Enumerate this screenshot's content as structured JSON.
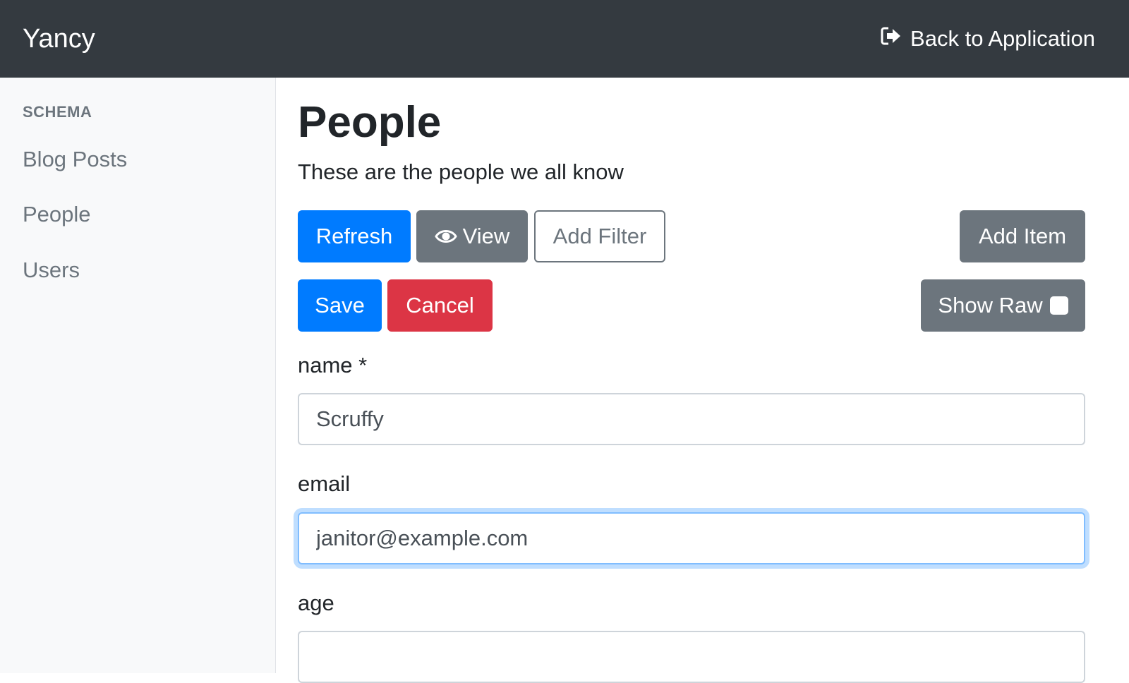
{
  "header": {
    "brand": "Yancy",
    "back_link": "Back to Application",
    "back_icon": "sign-out-icon"
  },
  "sidebar": {
    "heading": "SCHEMA",
    "items": [
      {
        "label": "Blog Posts"
      },
      {
        "label": "People"
      },
      {
        "label": "Users"
      }
    ]
  },
  "main": {
    "title": "People",
    "description": "These are the people we all know",
    "toolbar": {
      "refresh": "Refresh",
      "view": "View",
      "view_icon": "eye-icon",
      "add_filter": "Add Filter",
      "add_item": "Add Item"
    },
    "form_actions": {
      "save": "Save",
      "cancel": "Cancel",
      "show_raw": "Show Raw",
      "show_raw_checked": false
    },
    "fields": [
      {
        "label": "name *",
        "value": "Scruffy"
      },
      {
        "label": "email",
        "value": "janitor@example.com"
      },
      {
        "label": "age",
        "value": ""
      }
    ]
  },
  "colors": {
    "primary": "#007bff",
    "secondary": "#6c757d",
    "danger": "#dc3545",
    "navbar": "#343a40"
  }
}
